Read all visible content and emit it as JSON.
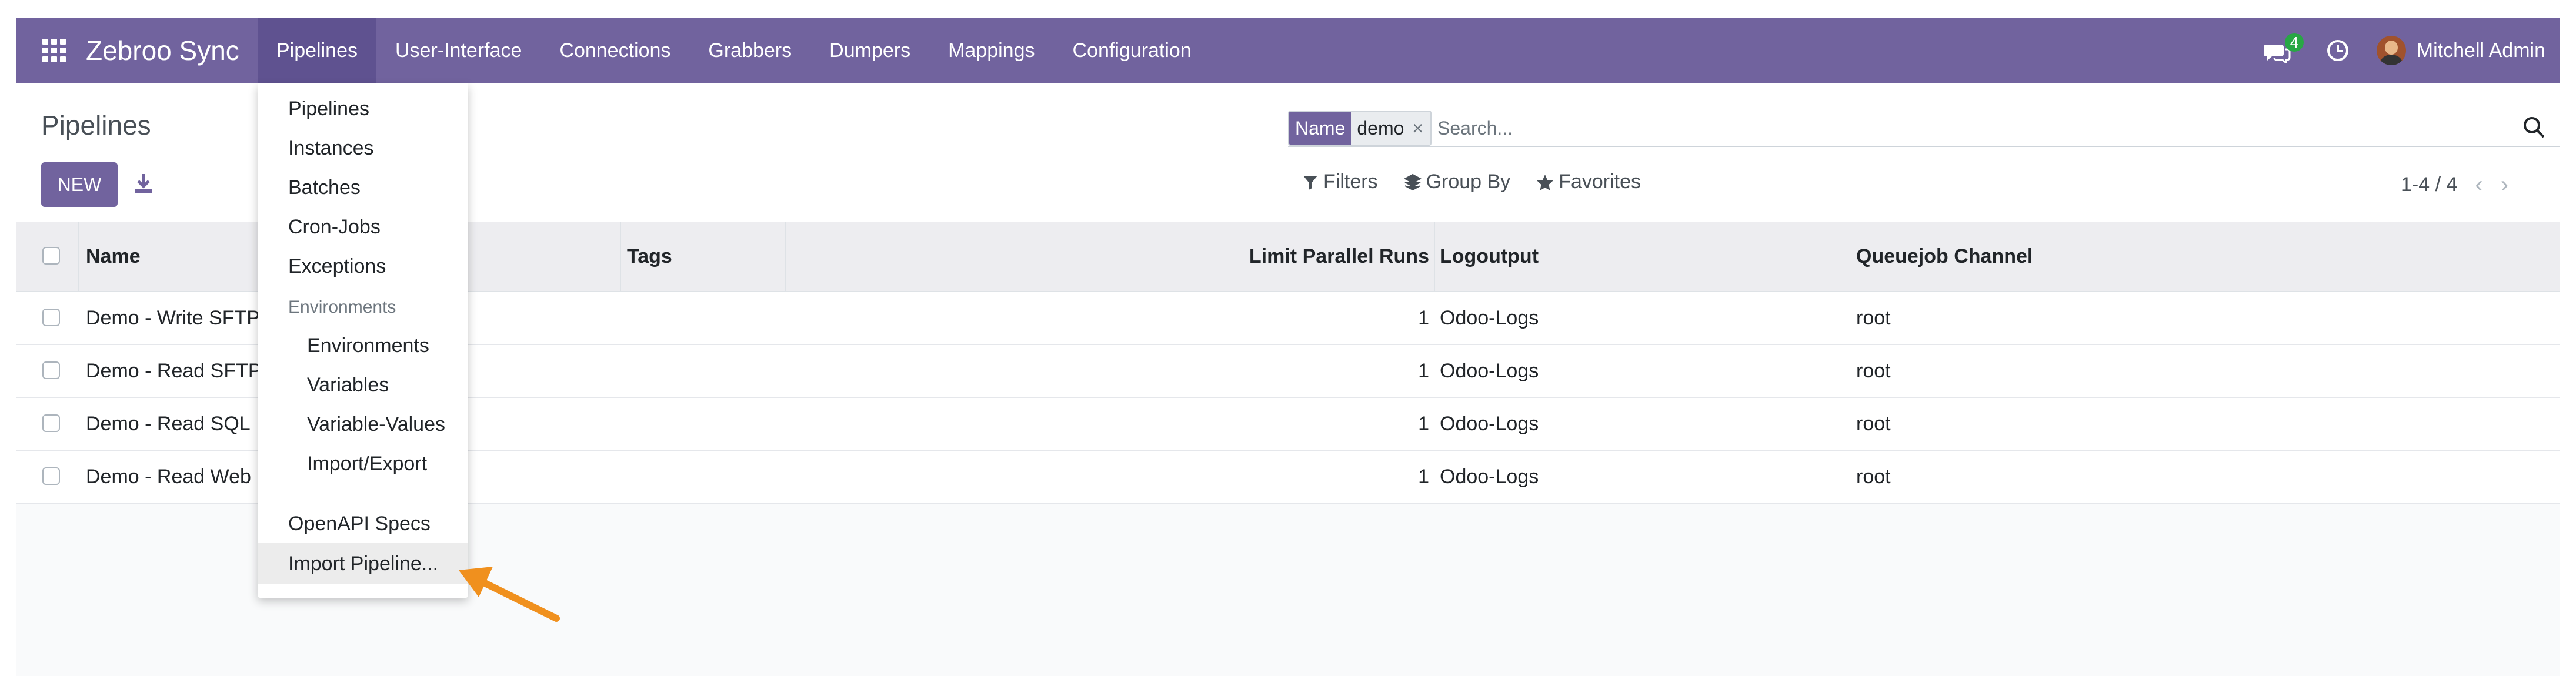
{
  "app": {
    "brand": "Zebroo Sync"
  },
  "navbar": {
    "menu": [
      {
        "label": "Pipelines",
        "active": true
      },
      {
        "label": "User-Interface"
      },
      {
        "label": "Connections"
      },
      {
        "label": "Grabbers"
      },
      {
        "label": "Dumpers"
      },
      {
        "label": "Mappings"
      },
      {
        "label": "Configuration"
      }
    ],
    "messages_count": "4",
    "user_name": "Mitchell Admin",
    "accent_color": "#71639e"
  },
  "control": {
    "title": "Pipelines",
    "new_label": "NEW",
    "search": {
      "facet_name": "Name",
      "facet_value": "demo",
      "facet_remove": "×",
      "placeholder": "Search..."
    },
    "filters_label": "Filters",
    "group_by_label": "Group By",
    "favorites_label": "Favorites",
    "pager": "1-4 / 4"
  },
  "table": {
    "headers": {
      "name": "Name",
      "tags": "Tags",
      "limit": "Limit Parallel Runs",
      "logoutput": "Logoutput",
      "channel": "Queuejob Channel"
    },
    "rows": [
      {
        "name": "Demo - Write SFTP",
        "limit": "1",
        "logoutput": "Odoo-Logs",
        "channel": "root"
      },
      {
        "name": "Demo - Read SFTP",
        "limit": "1",
        "logoutput": "Odoo-Logs",
        "channel": "root"
      },
      {
        "name": "Demo - Read SQL",
        "limit": "1",
        "logoutput": "Odoo-Logs",
        "channel": "root"
      },
      {
        "name": "Demo - Read Web",
        "limit": "1",
        "logoutput": "Odoo-Logs",
        "channel": "root"
      }
    ]
  },
  "dropdown": {
    "items": [
      "Pipelines",
      "Instances",
      "Batches",
      "Cron-Jobs",
      "Exceptions"
    ],
    "env_header": "Environments",
    "env_items": [
      "Environments",
      "Variables",
      "Variable-Values",
      "Import/Export"
    ],
    "openapi": "OpenAPI Specs",
    "import": "Import Pipeline..."
  },
  "annotation": {
    "arrow_color": "#f0901e"
  }
}
